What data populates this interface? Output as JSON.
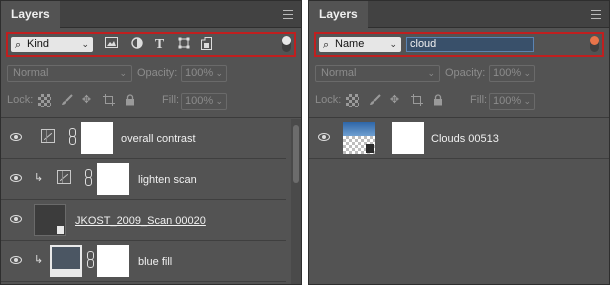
{
  "panels": [
    {
      "tab": "Layers",
      "filter": {
        "dropdown": "Kind",
        "icons": [
          "image-filter-icon",
          "adjustment-filter-icon",
          "type-filter-icon",
          "shape-filter-icon",
          "smart-object-filter-icon"
        ],
        "toggle_color": "#e8e8e8"
      },
      "blend_mode": "Normal",
      "opacity_label": "Opacity:",
      "opacity_value": "100%",
      "lock_label": "Lock:",
      "fill_label": "Fill:",
      "fill_value": "100%",
      "layers": [
        {
          "name": "overall contrast",
          "kind": "adjustment",
          "clipped": false
        },
        {
          "name": "lighten scan",
          "kind": "adjustment",
          "clipped": true
        },
        {
          "name": "JKOST_2009_Scan 00020",
          "kind": "smart-object",
          "clipped": false
        },
        {
          "name": "blue fill",
          "kind": "fill",
          "clipped": true
        }
      ]
    },
    {
      "tab": "Layers",
      "filter": {
        "dropdown": "Name",
        "search_value": "cloud",
        "toggle_color": "#e8744a"
      },
      "blend_mode": "Normal",
      "opacity_label": "Opacity:",
      "opacity_value": "100%",
      "lock_label": "Lock:",
      "fill_label": "Fill:",
      "fill_value": "100%",
      "layers": [
        {
          "name": "Clouds 00513",
          "kind": "smart-object",
          "clipped": false
        }
      ]
    }
  ],
  "colors": {
    "panel_bg": "#535353",
    "filter_highlight_border": "#c01f1f",
    "filter_active_toggle": "#e8744a"
  }
}
